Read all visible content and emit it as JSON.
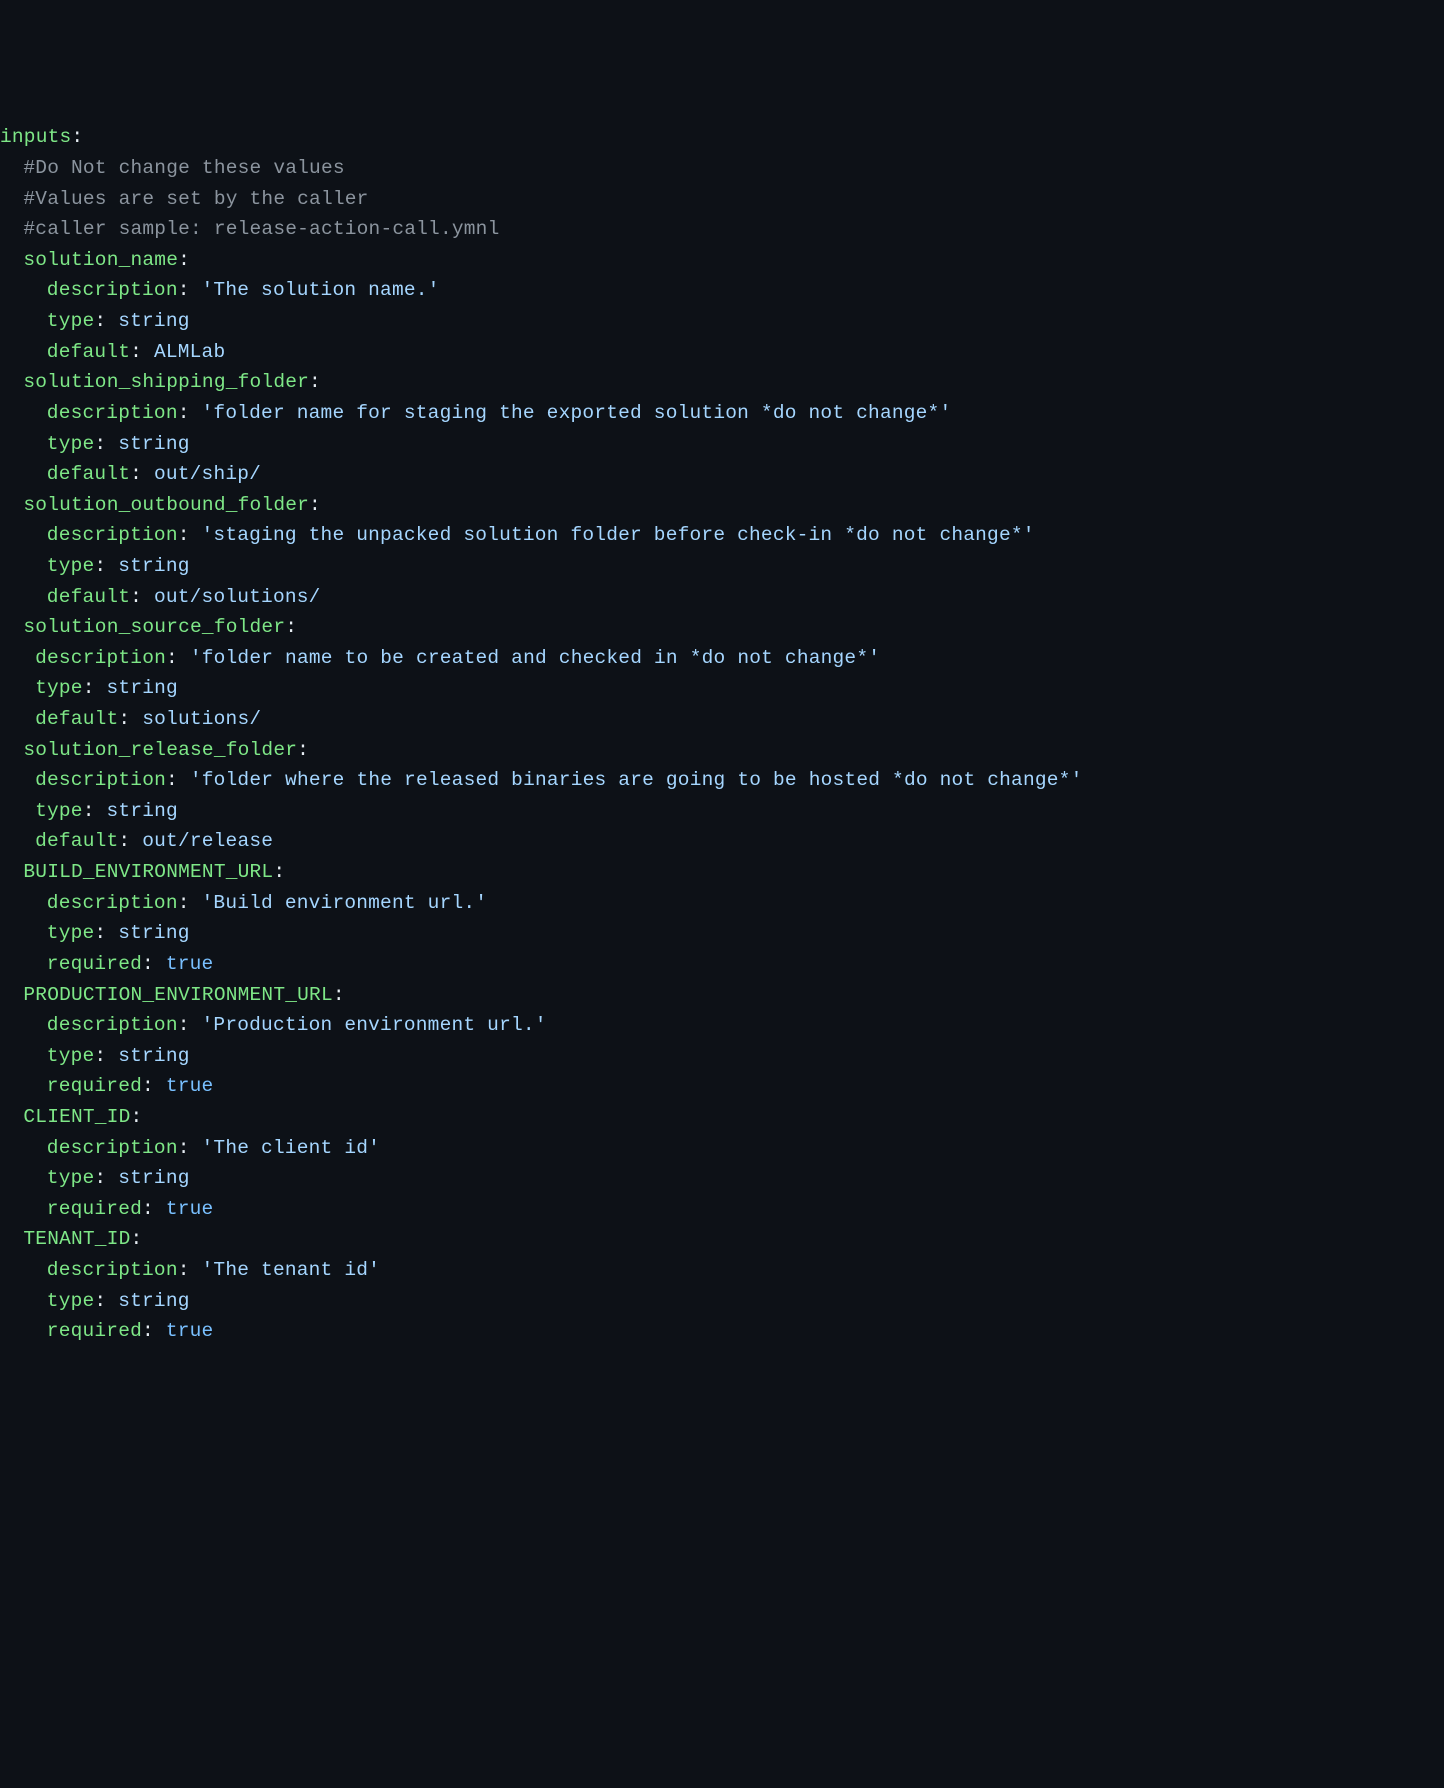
{
  "lines": [
    {
      "indent": "ind0",
      "parts": [
        {
          "cls": "key",
          "t": "inputs"
        },
        {
          "cls": "colon",
          "t": ":"
        }
      ]
    },
    {
      "indent": "ind1",
      "parts": [
        {
          "cls": "comment",
          "t": "#Do Not change these values"
        }
      ]
    },
    {
      "indent": "ind1",
      "parts": [
        {
          "cls": "comment",
          "t": "#Values are set by the caller"
        }
      ]
    },
    {
      "indent": "ind1",
      "parts": [
        {
          "cls": "comment",
          "t": "#caller sample: release-action-call.ymnl"
        }
      ]
    },
    {
      "indent": "ind1",
      "parts": [
        {
          "cls": "key",
          "t": "solution_name"
        },
        {
          "cls": "colon",
          "t": ":"
        }
      ]
    },
    {
      "indent": "ind2",
      "parts": [
        {
          "cls": "key",
          "t": "description"
        },
        {
          "cls": "colon",
          "t": ": "
        },
        {
          "cls": "string",
          "t": "'The solution name.'"
        }
      ]
    },
    {
      "indent": "ind2",
      "parts": [
        {
          "cls": "key",
          "t": "type"
        },
        {
          "cls": "colon",
          "t": ": "
        },
        {
          "cls": "value",
          "t": "string"
        }
      ]
    },
    {
      "indent": "ind2",
      "parts": [
        {
          "cls": "key",
          "t": "default"
        },
        {
          "cls": "colon",
          "t": ": "
        },
        {
          "cls": "value",
          "t": "ALMLab"
        }
      ]
    },
    {
      "indent": "ind1",
      "parts": [
        {
          "cls": "key",
          "t": "solution_shipping_folder"
        },
        {
          "cls": "colon",
          "t": ":"
        }
      ]
    },
    {
      "indent": "ind2",
      "parts": [
        {
          "cls": "key",
          "t": "description"
        },
        {
          "cls": "colon",
          "t": ": "
        },
        {
          "cls": "string",
          "t": "'folder name for staging the exported solution *do not change*'"
        }
      ]
    },
    {
      "indent": "ind2",
      "parts": [
        {
          "cls": "key",
          "t": "type"
        },
        {
          "cls": "colon",
          "t": ": "
        },
        {
          "cls": "value",
          "t": "string"
        }
      ]
    },
    {
      "indent": "ind2",
      "parts": [
        {
          "cls": "key",
          "t": "default"
        },
        {
          "cls": "colon",
          "t": ": "
        },
        {
          "cls": "value",
          "t": "out/ship/"
        }
      ]
    },
    {
      "indent": "ind1",
      "parts": [
        {
          "cls": "key",
          "t": "solution_outbound_folder"
        },
        {
          "cls": "colon",
          "t": ":"
        }
      ]
    },
    {
      "indent": "ind2",
      "parts": [
        {
          "cls": "key",
          "t": "description"
        },
        {
          "cls": "colon",
          "t": ": "
        },
        {
          "cls": "string",
          "t": "'staging the unpacked solution folder before check-in *do not change*'"
        }
      ]
    },
    {
      "indent": "ind2",
      "parts": [
        {
          "cls": "key",
          "t": "type"
        },
        {
          "cls": "colon",
          "t": ": "
        },
        {
          "cls": "value",
          "t": "string"
        }
      ]
    },
    {
      "indent": "ind2",
      "parts": [
        {
          "cls": "key",
          "t": "default"
        },
        {
          "cls": "colon",
          "t": ": "
        },
        {
          "cls": "value",
          "t": "out/solutions/"
        }
      ]
    },
    {
      "indent": "ind1",
      "parts": [
        {
          "cls": "key",
          "t": "solution_source_folder"
        },
        {
          "cls": "colon",
          "t": ":"
        }
      ]
    },
    {
      "indent": "ind1b",
      "parts": [
        {
          "cls": "key",
          "t": "description"
        },
        {
          "cls": "colon",
          "t": ": "
        },
        {
          "cls": "string",
          "t": "'folder name to be created and checked in *do not change*'"
        }
      ]
    },
    {
      "indent": "ind1b",
      "parts": [
        {
          "cls": "key",
          "t": "type"
        },
        {
          "cls": "colon",
          "t": ": "
        },
        {
          "cls": "value",
          "t": "string"
        }
      ]
    },
    {
      "indent": "ind1b",
      "parts": [
        {
          "cls": "key",
          "t": "default"
        },
        {
          "cls": "colon",
          "t": ": "
        },
        {
          "cls": "value",
          "t": "solutions/"
        }
      ]
    },
    {
      "indent": "ind1",
      "parts": [
        {
          "cls": "key",
          "t": "solution_release_folder"
        },
        {
          "cls": "colon",
          "t": ":"
        }
      ]
    },
    {
      "indent": "ind1b",
      "parts": [
        {
          "cls": "key",
          "t": "description"
        },
        {
          "cls": "colon",
          "t": ": "
        },
        {
          "cls": "string",
          "t": "'folder where the released binaries are going to be hosted *do not change*'"
        }
      ]
    },
    {
      "indent": "ind1b",
      "parts": [
        {
          "cls": "key",
          "t": "type"
        },
        {
          "cls": "colon",
          "t": ": "
        },
        {
          "cls": "value",
          "t": "string"
        }
      ]
    },
    {
      "indent": "ind1b",
      "parts": [
        {
          "cls": "key",
          "t": "default"
        },
        {
          "cls": "colon",
          "t": ": "
        },
        {
          "cls": "value",
          "t": "out/release"
        }
      ]
    },
    {
      "indent": "ind1",
      "parts": [
        {
          "cls": "key",
          "t": "BUILD_ENVIRONMENT_URL"
        },
        {
          "cls": "colon",
          "t": ":"
        }
      ]
    },
    {
      "indent": "ind2",
      "parts": [
        {
          "cls": "key",
          "t": "description"
        },
        {
          "cls": "colon",
          "t": ": "
        },
        {
          "cls": "string",
          "t": "'Build environment url.'"
        }
      ]
    },
    {
      "indent": "ind2",
      "parts": [
        {
          "cls": "key",
          "t": "type"
        },
        {
          "cls": "colon",
          "t": ": "
        },
        {
          "cls": "value",
          "t": "string"
        }
      ]
    },
    {
      "indent": "ind2",
      "parts": [
        {
          "cls": "key",
          "t": "required"
        },
        {
          "cls": "colon",
          "t": ": "
        },
        {
          "cls": "bool",
          "t": "true"
        }
      ]
    },
    {
      "indent": "ind1",
      "parts": [
        {
          "cls": "key",
          "t": "PRODUCTION_ENVIRONMENT_URL"
        },
        {
          "cls": "colon",
          "t": ":"
        }
      ]
    },
    {
      "indent": "ind2",
      "parts": [
        {
          "cls": "key",
          "t": "description"
        },
        {
          "cls": "colon",
          "t": ": "
        },
        {
          "cls": "string",
          "t": "'Production environment url.'"
        }
      ]
    },
    {
      "indent": "ind2",
      "parts": [
        {
          "cls": "key",
          "t": "type"
        },
        {
          "cls": "colon",
          "t": ": "
        },
        {
          "cls": "value",
          "t": "string"
        }
      ]
    },
    {
      "indent": "ind2",
      "parts": [
        {
          "cls": "key",
          "t": "required"
        },
        {
          "cls": "colon",
          "t": ": "
        },
        {
          "cls": "bool",
          "t": "true"
        }
      ]
    },
    {
      "indent": "ind1",
      "parts": [
        {
          "cls": "key",
          "t": "CLIENT_ID"
        },
        {
          "cls": "colon",
          "t": ":"
        }
      ]
    },
    {
      "indent": "ind2",
      "parts": [
        {
          "cls": "key",
          "t": "description"
        },
        {
          "cls": "colon",
          "t": ": "
        },
        {
          "cls": "string",
          "t": "'The client id'"
        }
      ]
    },
    {
      "indent": "ind2",
      "parts": [
        {
          "cls": "key",
          "t": "type"
        },
        {
          "cls": "colon",
          "t": ": "
        },
        {
          "cls": "value",
          "t": "string"
        }
      ]
    },
    {
      "indent": "ind2",
      "parts": [
        {
          "cls": "key",
          "t": "required"
        },
        {
          "cls": "colon",
          "t": ": "
        },
        {
          "cls": "bool",
          "t": "true"
        }
      ]
    },
    {
      "indent": "ind1",
      "parts": [
        {
          "cls": "key",
          "t": "TENANT_ID"
        },
        {
          "cls": "colon",
          "t": ":"
        }
      ]
    },
    {
      "indent": "ind2",
      "parts": [
        {
          "cls": "key",
          "t": "description"
        },
        {
          "cls": "colon",
          "t": ": "
        },
        {
          "cls": "string",
          "t": "'The tenant id'"
        }
      ]
    },
    {
      "indent": "ind2",
      "parts": [
        {
          "cls": "key",
          "t": "type"
        },
        {
          "cls": "colon",
          "t": ": "
        },
        {
          "cls": "value",
          "t": "string"
        }
      ]
    },
    {
      "indent": "ind2",
      "parts": [
        {
          "cls": "key",
          "t": "required"
        },
        {
          "cls": "colon",
          "t": ": "
        },
        {
          "cls": "bool",
          "t": "true"
        }
      ]
    }
  ]
}
